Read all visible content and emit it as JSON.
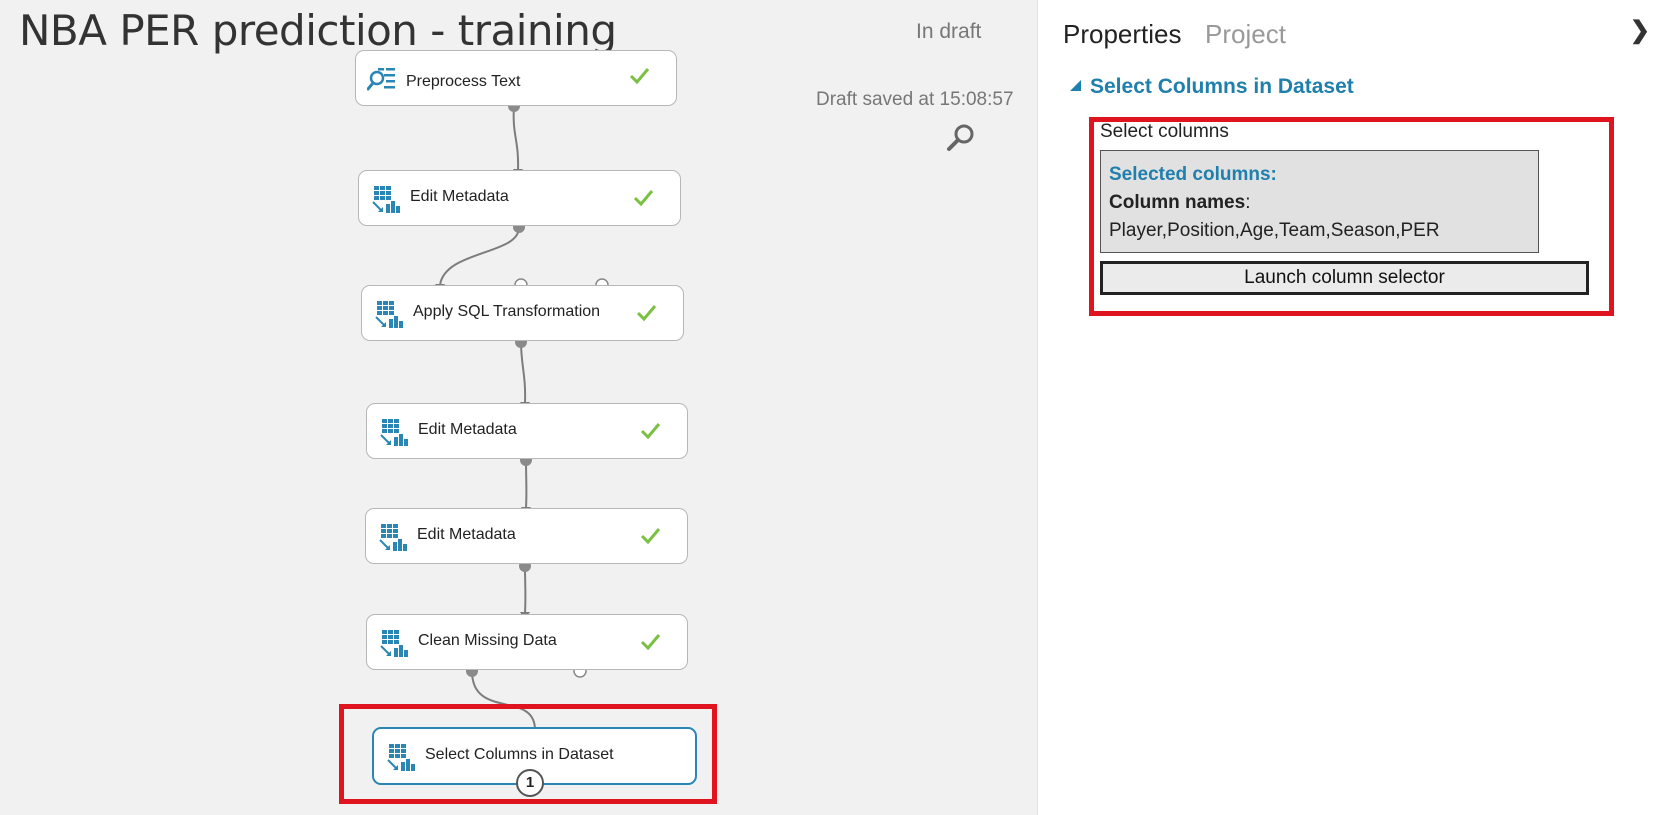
{
  "header": {
    "title": "NBA PER prediction - training",
    "status": "In draft",
    "saved": "Draft saved at 15:08:57"
  },
  "modules": [
    {
      "label": "Preprocess Text",
      "icon": "text-search-icon",
      "done": true
    },
    {
      "label": "Edit Metadata",
      "icon": "dataset-icon",
      "done": true
    },
    {
      "label": "Apply SQL Transformation",
      "icon": "dataset-icon",
      "done": true
    },
    {
      "label": "Edit Metadata",
      "icon": "dataset-icon",
      "done": true
    },
    {
      "label": "Edit Metadata",
      "icon": "dataset-icon",
      "done": true
    },
    {
      "label": "Clean Missing Data",
      "icon": "dataset-icon",
      "done": true
    },
    {
      "label": "Select Columns in Dataset",
      "icon": "dataset-icon",
      "done": false,
      "selected": true,
      "badge": "1"
    }
  ],
  "panel": {
    "tabs": [
      "Properties",
      "Project"
    ],
    "active_tab": "Properties",
    "collapse_glyph": "❯",
    "section_title": "Select Columns in Dataset",
    "field_label": "Select columns",
    "selected_label": "Selected columns:",
    "column_names_label": "Column names",
    "column_names_sep": ":",
    "column_names_value": "Player,Position,Age,Team,Season,PER",
    "launch_button": "Launch column selector"
  },
  "colors": {
    "accent": "#1f7fad",
    "check": "#7ac143",
    "highlight": "#e0141e",
    "canvas": "#f1f1f1"
  }
}
